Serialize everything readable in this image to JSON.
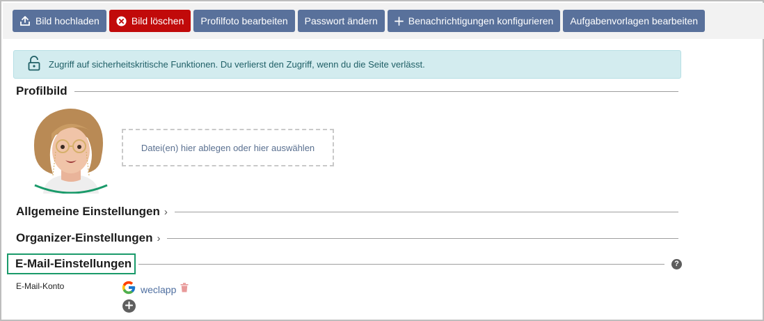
{
  "toolbar": {
    "upload_label": "Bild hochladen",
    "delete_label": "Bild löschen",
    "edit_photo_label": "Profilfoto bearbeiten",
    "change_password_label": "Passwort ändern",
    "notifications_label": "Benachrichtigungen konfigurieren",
    "task_templates_label": "Aufgabenvorlagen bearbeiten"
  },
  "alert": {
    "text": "Zugriff auf sicherheitskritische Funktionen. Du verlierst den Zugriff, wenn du die Seite verlässt."
  },
  "profile": {
    "section_title": "Profilbild",
    "dropzone_text": "Datei(en) hier ablegen oder hier auswählen"
  },
  "sections": {
    "general": "Allgemeine Einstellungen",
    "organizer": "Organizer-Einstellungen",
    "email": "E-Mail-Einstellungen"
  },
  "email": {
    "account_label": "E-Mail-Konto",
    "account_name": "weclapp",
    "help_symbol": "?"
  },
  "icons": {
    "upload": "upload-icon",
    "delete": "x-circle-icon",
    "add": "plus-icon",
    "lock": "unlock-icon",
    "google": "google-icon",
    "trash": "trash-icon",
    "help": "question-circle-icon"
  },
  "colors": {
    "primary_button": "#59719b",
    "danger_button": "#c10a0a",
    "alert_bg": "#d3ecef",
    "highlight_border": "#1a9a6a",
    "link": "#4f6fa0"
  }
}
